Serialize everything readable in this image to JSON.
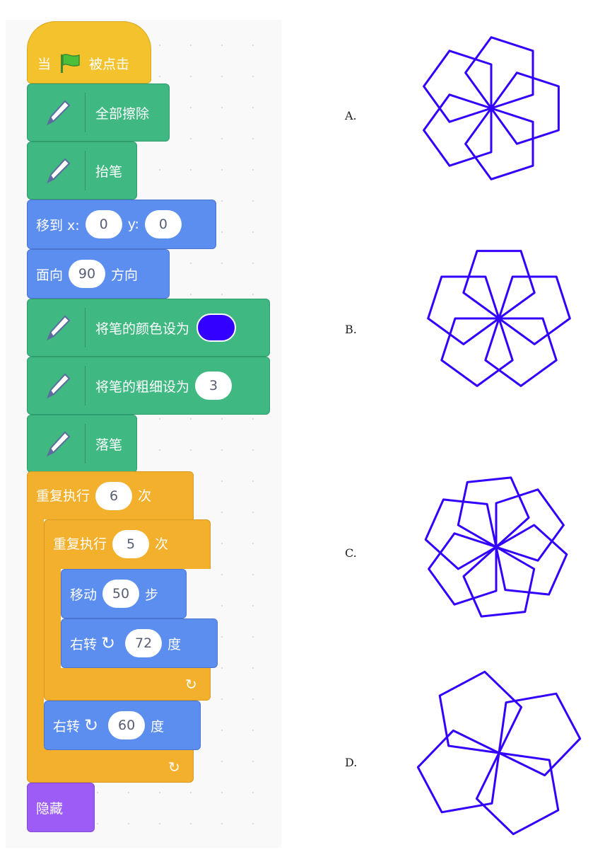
{
  "script": {
    "hat": {
      "prefix": "当",
      "flag_icon": "green-flag-icon",
      "suffix": "被点击"
    },
    "clear_label": "全部擦除",
    "pen_up_label": "抬笔",
    "goto": {
      "label": "移到 x:",
      "x": "0",
      "y_label": "y:",
      "y": "0"
    },
    "point": {
      "label": "面向",
      "value": "90",
      "suffix": "方向"
    },
    "set_color": {
      "label": "将笔的颜色设为",
      "color": "#3300ff"
    },
    "set_size": {
      "label": "将笔的粗细设为",
      "value": "3"
    },
    "pen_down_label": "落笔",
    "outer_repeat": {
      "label": "重复执行",
      "count": "6",
      "suffix": "次"
    },
    "inner_repeat": {
      "label": "重复执行",
      "count": "5",
      "suffix": "次"
    },
    "move": {
      "label": "移动",
      "steps": "50",
      "suffix": "步"
    },
    "turn_inner": {
      "label": "右转",
      "degrees": "72",
      "suffix": "度"
    },
    "turn_outer": {
      "label": "右转",
      "degrees": "60",
      "suffix": "度"
    },
    "hide_label": "隐藏"
  },
  "options": [
    {
      "label": "A.",
      "petals": 5
    },
    {
      "label": "B.",
      "petals": 5
    },
    {
      "label": "C.",
      "petals": 6
    },
    {
      "label": "D.",
      "petals": 4
    }
  ],
  "colors": {
    "stroke": "#3300ff",
    "pen": "#3fb882",
    "motion": "#5c8ef0",
    "control": "#f2b02c",
    "event": "#f3c22d",
    "looks": "#9d5cf5"
  }
}
